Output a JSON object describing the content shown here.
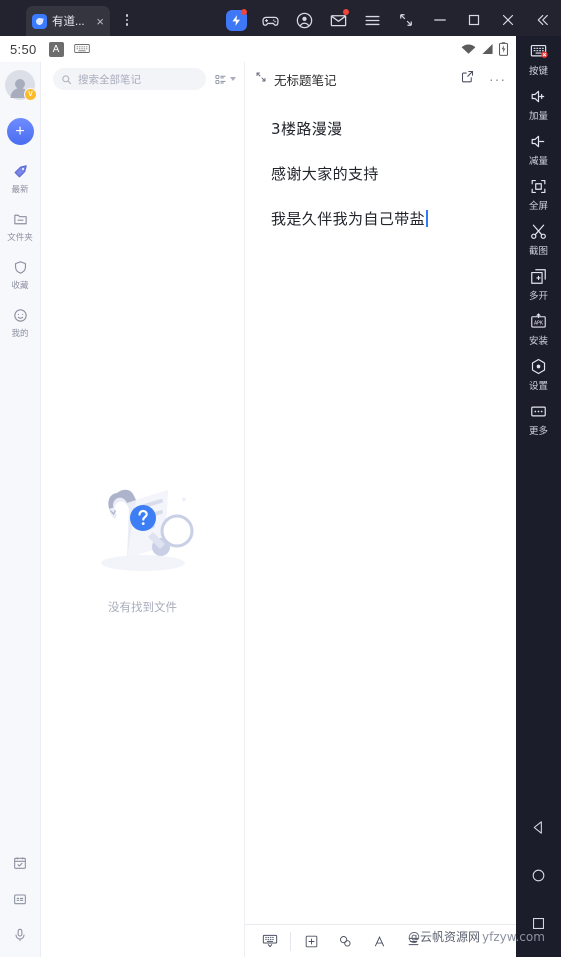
{
  "window": {
    "tab_label": "有道...",
    "close_label": "×",
    "menu_icon": "vertical-dots-icon",
    "controls": {
      "boost_icon": "lightning-boost-icon",
      "gamepad_icon": "gamepad-icon",
      "account_icon": "account-circle-icon",
      "mail_icon": "mail-icon",
      "menu_icon": "hamburger-menu-icon",
      "shrink_icon": "shrink-window-icon",
      "minimize_icon": "minimize-icon",
      "maximize_icon": "maximize-icon",
      "close_icon": "close-icon",
      "collapse_icon": "double-chevron-left-icon"
    }
  },
  "statusbar": {
    "time": "5:50",
    "ime_label": "A",
    "keyboard_icon": "keyboard-icon",
    "wifi_icon": "wifi-icon",
    "signal_icon": "signal-icon",
    "battery_icon": "battery-charging-icon"
  },
  "rail": {
    "avatar_badge": "V",
    "add_label": "+",
    "items": [
      {
        "label": "最新",
        "icon": "tag-icon"
      },
      {
        "label": "文件夹",
        "icon": "folder-icon"
      },
      {
        "label": "收藏",
        "icon": "shield-icon"
      },
      {
        "label": "我的",
        "icon": "smiley-icon"
      }
    ],
    "bottom": [
      {
        "icon": "calendar-icon"
      },
      {
        "icon": "ocr-scan-icon"
      },
      {
        "icon": "microphone-icon"
      }
    ]
  },
  "list": {
    "search_placeholder": "搜索全部笔记",
    "search_icon": "search-icon",
    "view_toggle_icon": "list-view-icon",
    "empty_text": "没有找到文件",
    "empty_illustration": "document-magnifier-question-icon"
  },
  "editor": {
    "collapse_icon": "collapse-arrows-icon",
    "title": "无标题笔记",
    "share_icon": "share-export-icon",
    "more_label": "···",
    "lines": [
      "3楼路漫漫",
      "感谢大家的支持",
      "我是久伴我为自己带盐"
    ],
    "toolbar": [
      {
        "icon": "hide-keyboard-icon"
      },
      {
        "icon": "plus-box-icon"
      },
      {
        "icon": "attachment-link-icon"
      },
      {
        "icon": "font-a-icon"
      },
      {
        "icon": "align-list-icon"
      }
    ]
  },
  "sidebar": {
    "items": [
      {
        "label": "按键",
        "icon": "keymapping-icon"
      },
      {
        "label": "加量",
        "icon": "volume-up-icon"
      },
      {
        "label": "减量",
        "icon": "volume-down-icon"
      },
      {
        "label": "全屏",
        "icon": "fullscreen-icon"
      },
      {
        "label": "截图",
        "icon": "scissors-screenshot-icon"
      },
      {
        "label": "多开",
        "icon": "multi-instance-icon"
      },
      {
        "label": "安装",
        "icon": "apk-install-icon"
      },
      {
        "label": "设置",
        "icon": "settings-gear-icon"
      },
      {
        "label": "更多",
        "icon": "more-dots-icon"
      }
    ],
    "nav": [
      {
        "icon": "android-back-icon"
      },
      {
        "icon": "android-home-icon"
      },
      {
        "icon": "android-recents-icon"
      }
    ]
  },
  "watermark": {
    "cn": "@云帆资源网",
    "en": "yfzyw.com"
  },
  "colors": {
    "accent": "#3f78f6",
    "chrome_bg": "#1c1d2b",
    "titlebar_bg": "#22232f",
    "rail_bg": "#f7f8fb",
    "caret": "#2f7cf6",
    "badge_red": "#f0453a",
    "vip_yellow": "#fcbb2b"
  }
}
